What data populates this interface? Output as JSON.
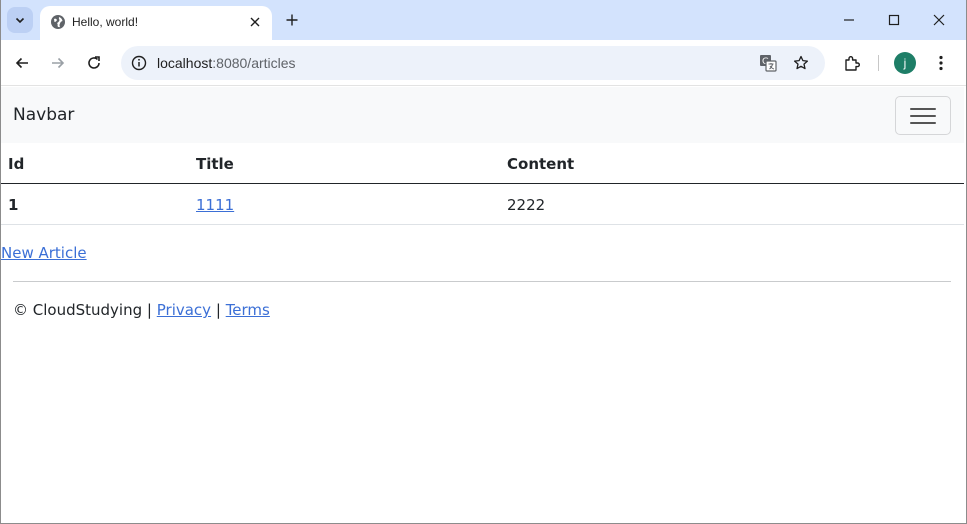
{
  "browser": {
    "tab_title": "Hello, world!",
    "url_host": "localhost",
    "url_rest": ":8080/articles",
    "avatar_letter": "j",
    "icons": [
      "tab-search-icon",
      "globe-icon",
      "close-icon",
      "plus-icon",
      "minimize-icon",
      "maximize-icon",
      "window-close-icon",
      "back-arrow-icon",
      "forward-arrow-icon",
      "reload-icon",
      "info-icon",
      "translate-icon",
      "star-icon",
      "extensions-icon",
      "kebab-menu-icon"
    ],
    "colors": {
      "tabstrip": "#d3e3fd",
      "omnibox": "#edf2fa",
      "avatar": "#1e7e67"
    }
  },
  "navbar": {
    "brand": "Navbar",
    "toggler_icon": "hamburger-icon"
  },
  "table": {
    "headers": [
      "Id",
      "Title",
      "Content"
    ],
    "rows": [
      {
        "id": "1",
        "title": "1111",
        "content": "2222"
      }
    ]
  },
  "new_article_link": "New Article",
  "footer": {
    "copyright": "© CloudStudying",
    "separator": "|",
    "privacy": "Privacy",
    "terms": "Terms"
  }
}
